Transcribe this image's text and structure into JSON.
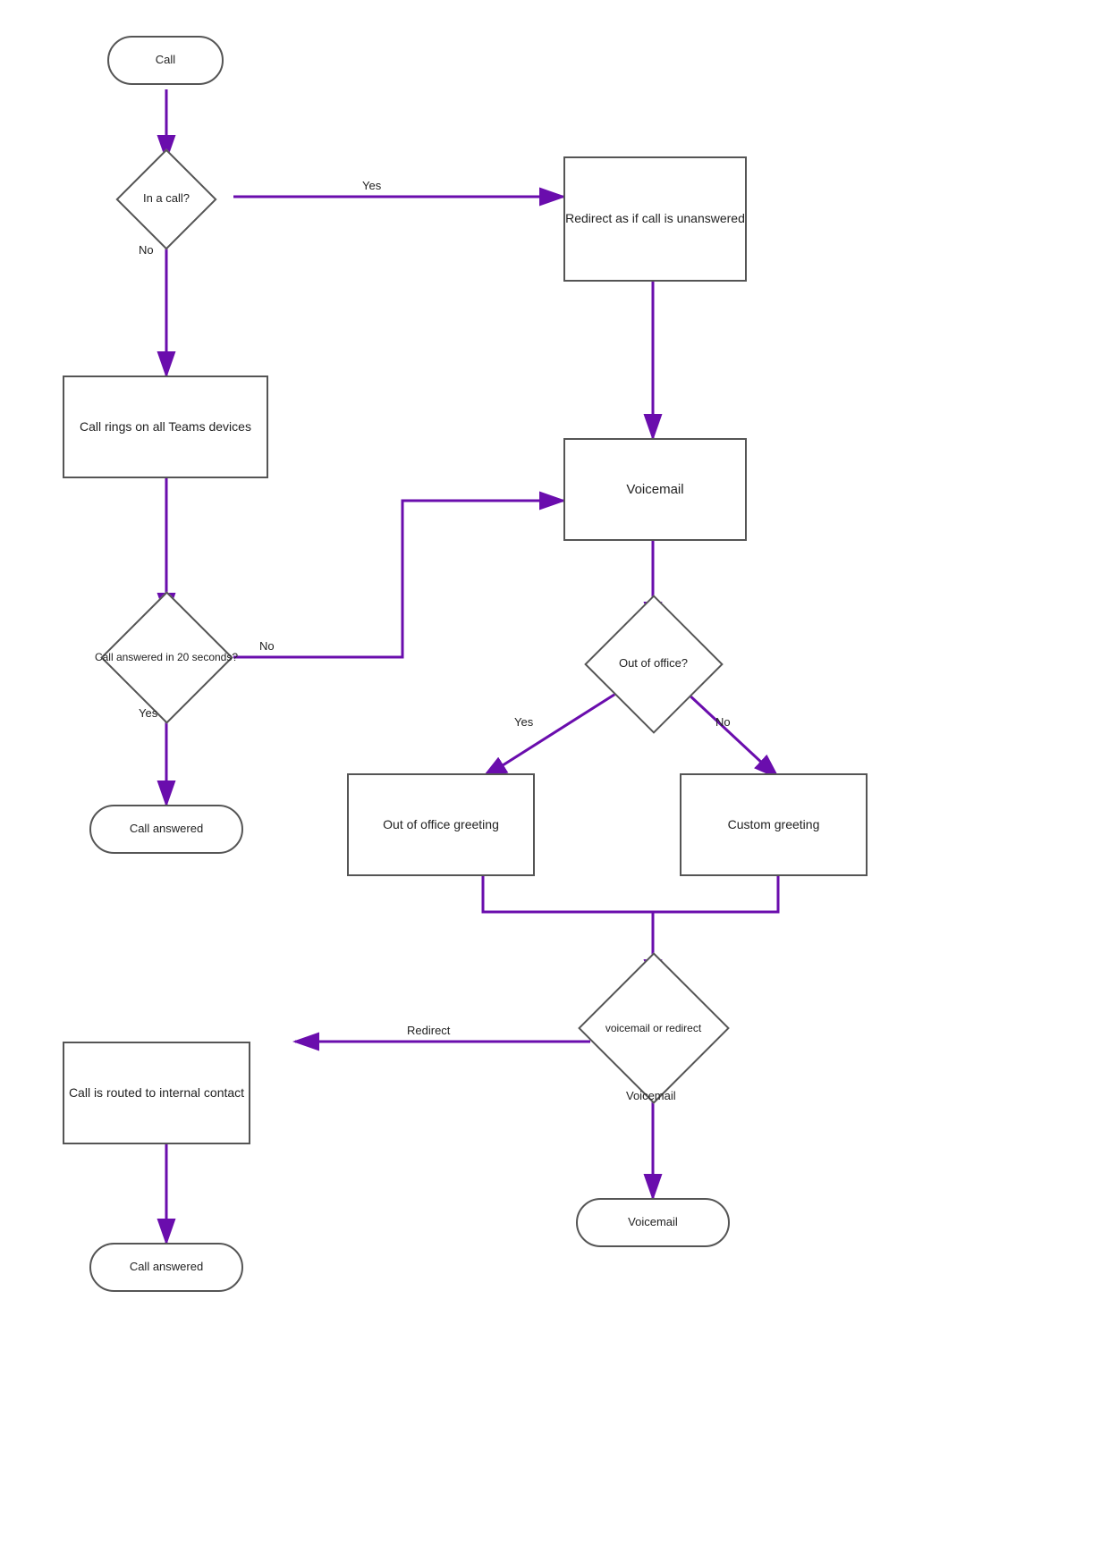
{
  "nodes": {
    "call": {
      "label": "Call"
    },
    "in_a_call": {
      "label": "In a call?"
    },
    "redirect_unanswered": {
      "label": "Redirect as if call is unanswered"
    },
    "call_rings": {
      "label": "Call rings on all Teams devices"
    },
    "voicemail_box": {
      "label": "Voicemail"
    },
    "call_answered_20": {
      "label": "Call answered in 20 seconds?"
    },
    "out_of_office": {
      "label": "Out of office?"
    },
    "call_answered_yes": {
      "label": "Call answered"
    },
    "ooo_greeting": {
      "label": "Out of office greeting"
    },
    "custom_greeting": {
      "label": "Custom greeting"
    },
    "voicemail_or_redirect": {
      "label": "voicemail or redirect"
    },
    "call_routed": {
      "label": "Call is routed to internal contact"
    },
    "call_answered_final": {
      "label": "Call answered"
    },
    "voicemail_final": {
      "label": "Voicemail"
    }
  },
  "labels": {
    "yes": "Yes",
    "no": "No",
    "voicemail": "Voicemail",
    "redirect": "Redirect"
  },
  "colors": {
    "arrow": "#6a0dad",
    "border": "#555"
  }
}
